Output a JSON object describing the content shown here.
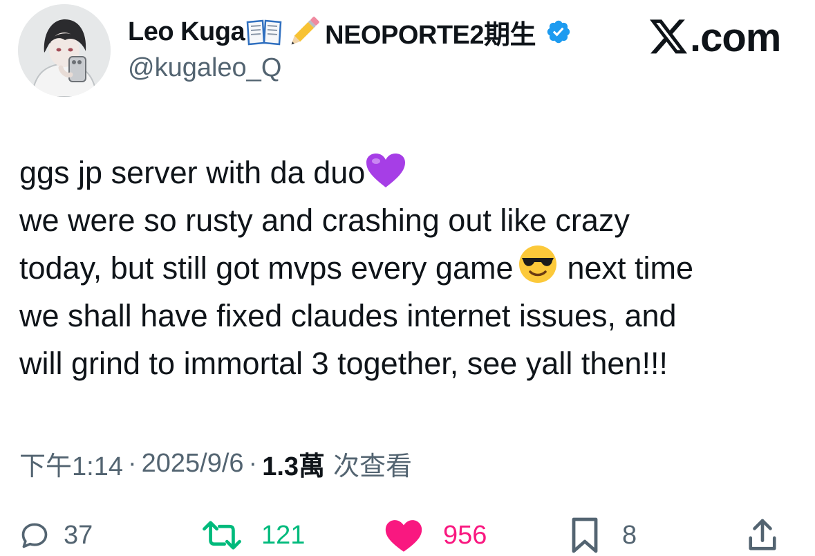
{
  "author": {
    "display_name": "Leo Kuga",
    "display_name_suffix": "NEOPORTE2期生",
    "name_emojis": [
      "open-book-emoji",
      "pencil-emoji"
    ],
    "handle": "@kugaleo_Q",
    "verified": true
  },
  "brand": {
    "label": ".com"
  },
  "tweet": {
    "lines": [
      "ggs jp server with da duo",
      "we were so rusty and crashing out like crazy",
      "today, but still got mvps every game",
      "next time",
      "we shall have fixed claudes internet issues, and",
      "will grind to immortal 3 together, see yall then!!!"
    ],
    "emojis": [
      "purple-heart-emoji",
      "sunglasses-emoji"
    ]
  },
  "meta": {
    "time": "下午1:14",
    "separator": "·",
    "date": "2025/9/6",
    "views_count": "1.3萬",
    "views_label": "次查看"
  },
  "actions": {
    "replies": "37",
    "retweets": "121",
    "likes": "956",
    "bookmarks": "8"
  },
  "colors": {
    "text": "#0f1419",
    "secondary": "#536471",
    "verified": "#1d9bf0",
    "retweet": "#00ba7c",
    "like": "#f91880"
  }
}
